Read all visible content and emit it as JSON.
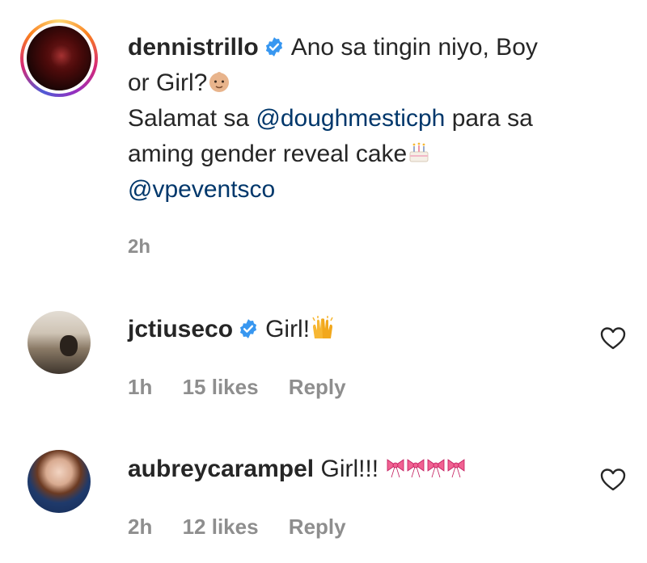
{
  "caption": {
    "username": "dennistrillo",
    "text_line1": "Ano sa tingin niyo, Boy",
    "text_line2": "or Girl?",
    "text_line3a": "Salamat sa",
    "mention1": "@doughmesticph",
    "text_line3b": "para sa",
    "text_line4": "aming gender reveal cake",
    "mention2": "@vpeventsco",
    "time": "2h",
    "emojis": [
      "baby-face-emoji",
      "birthday-cake-emoji"
    ]
  },
  "comments": [
    {
      "username": "jctiuseco",
      "verified": true,
      "text": "Girl!",
      "emoji": "raising-hands-emoji",
      "time": "1h",
      "likes": "15 likes",
      "reply": "Reply"
    },
    {
      "username": "aubreycarampel",
      "verified": false,
      "text": "Girl!!!",
      "emoji": "pink-ribbon-emoji x4",
      "time": "2h",
      "likes": "12 likes",
      "reply": "Reply"
    }
  ],
  "colors": {
    "text": "#262626",
    "muted": "#8e8e8e",
    "mention": "#00376b",
    "verified": "#3897f0"
  }
}
